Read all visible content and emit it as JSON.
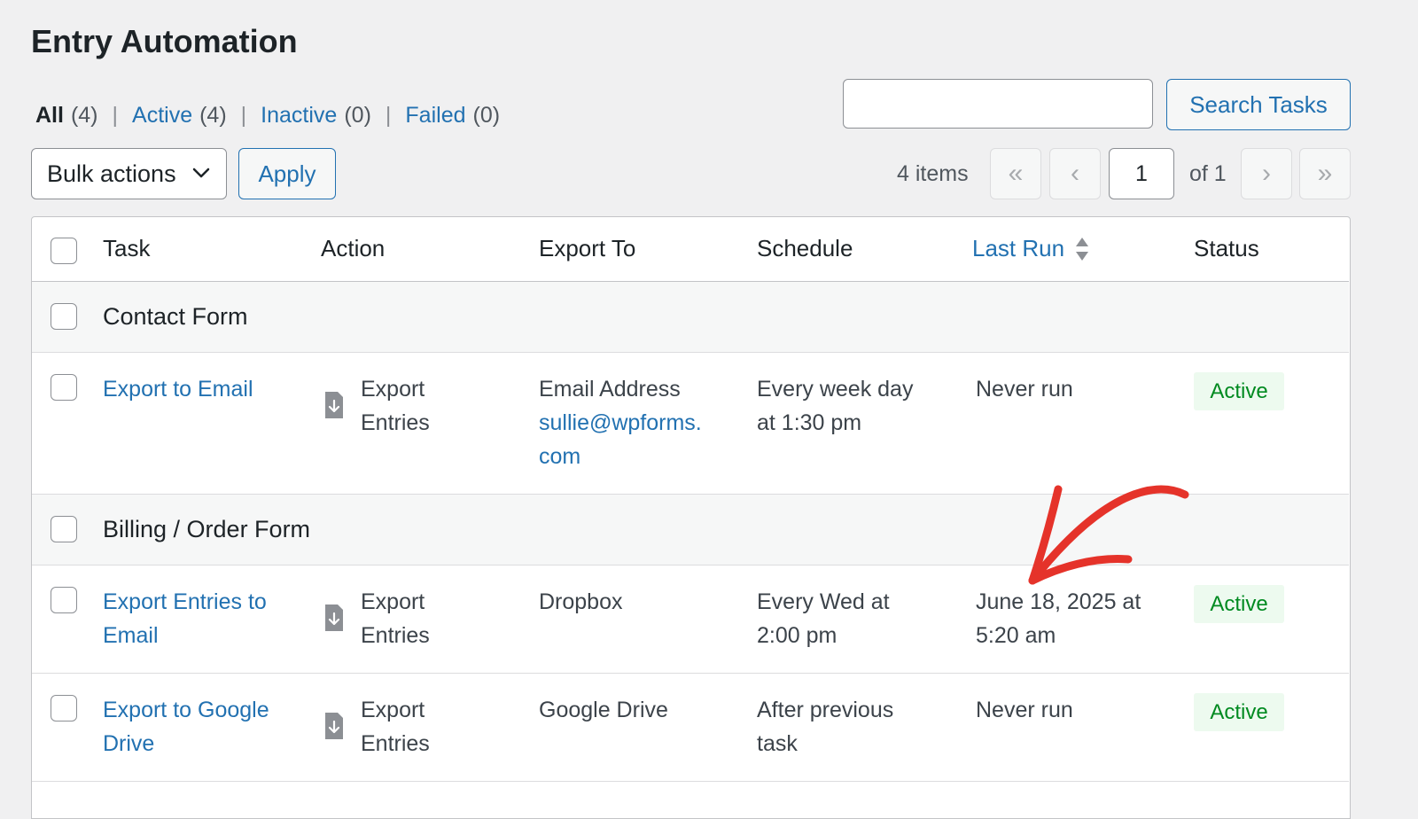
{
  "page": {
    "title": "Entry Automation"
  },
  "filters": [
    {
      "label": "All",
      "count": "(4)"
    },
    {
      "label": "Active",
      "count": "(4)"
    },
    {
      "label": "Inactive",
      "count": "(0)"
    },
    {
      "label": "Failed",
      "count": "(0)"
    }
  ],
  "search": {
    "placeholder": "",
    "button_label": "Search Tasks"
  },
  "bulk": {
    "selected": "Bulk actions",
    "apply_label": "Apply"
  },
  "pagination": {
    "items": "4 items",
    "first": "«",
    "prev": "‹",
    "current": "1",
    "of_total": "of 1",
    "next": "›",
    "last": "»"
  },
  "columns": {
    "task": "Task",
    "action": "Action",
    "export_to": "Export To",
    "schedule": "Schedule",
    "last_run": "Last Run",
    "status": "Status"
  },
  "groups": [
    {
      "name": "Contact Form",
      "rows": [
        {
          "task": "Export to Email",
          "action": [
            "Export",
            "Entries"
          ],
          "export_to": "Email Address",
          "export_to_link": [
            "sullie@wpforms.",
            "com"
          ],
          "schedule": [
            "Every week day",
            "at 1:30 pm"
          ],
          "last_run": [
            "Never run"
          ],
          "status": "Active"
        }
      ]
    },
    {
      "name": "Billing / Order Form",
      "rows": [
        {
          "task": [
            "Export Entries to",
            "Email"
          ],
          "action": [
            "Export",
            "Entries"
          ],
          "export_to": "Dropbox",
          "schedule": [
            "Every Wed at",
            "2:00 pm"
          ],
          "last_run": [
            "June 18, 2025 at",
            "5:20 am"
          ],
          "status": "Active"
        },
        {
          "task": [
            "Export to Google",
            "Drive"
          ],
          "action": [
            "Export",
            "Entries"
          ],
          "export_to": "Google Drive",
          "schedule": [
            "After previous",
            "task"
          ],
          "last_run": [
            "Never run"
          ],
          "status": "Active"
        }
      ]
    }
  ],
  "icons": {
    "dropdown": "chevron-down-icon",
    "sort": "sort-arrows-icon",
    "action": "document-download-icon",
    "annotation": "red-arrow-annotation"
  },
  "colors": {
    "link": "#2271b1",
    "status_bg": "#edfaef",
    "status_text": "#008a20",
    "annotation": "#e5332a"
  }
}
